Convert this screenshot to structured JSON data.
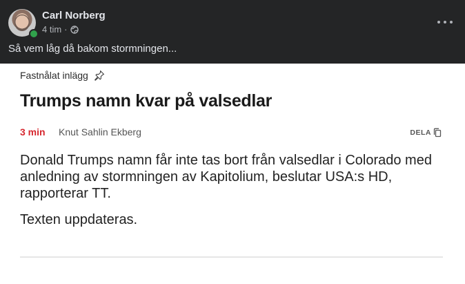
{
  "post": {
    "author": "Carl Norberg",
    "time": "4 tim",
    "separator": "·",
    "privacy_icon": "globe-icon",
    "text": "Så vem låg då bakom stormningen...",
    "more_icon": "more-horizontal-icon"
  },
  "article": {
    "pinned_label": "Fastnålat inlägg",
    "pinned_icon": "pin-icon",
    "headline": "Trumps namn kvar på valsedlar",
    "time_badge": "3 min",
    "byline": "Knut Sahlin Ekberg",
    "share_label": "DELA",
    "share_icon": "copy-icon",
    "body": "Donald Trumps namn får inte tas bort från valsedlar i Colorado med anledning av stormningen av Kapitolium, beslutar USA:s HD, rapporterar TT.",
    "update_note": "Texten uppdateras."
  },
  "colors": {
    "header_bg": "#242526",
    "accent_red": "#d6272e",
    "online_green": "#31a24c"
  }
}
